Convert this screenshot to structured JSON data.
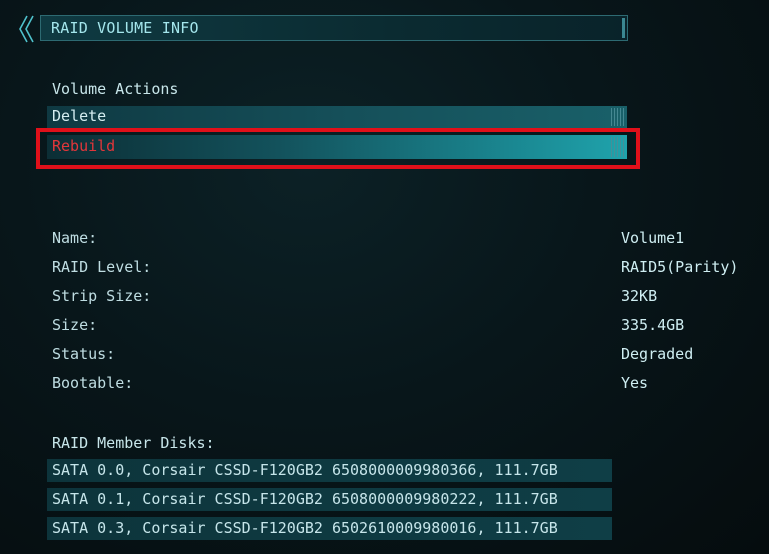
{
  "header": {
    "back_icon": "double-chevron-left-icon",
    "title": "RAID VOLUME INFO"
  },
  "volume_actions": {
    "heading": "Volume Actions",
    "items": [
      {
        "label": "Delete"
      },
      {
        "label": "Rebuild",
        "selected": true
      }
    ]
  },
  "info": {
    "rows": [
      {
        "label": "Name:",
        "value": "Volume1"
      },
      {
        "label": "RAID Level:",
        "value": "RAID5(Parity)"
      },
      {
        "label": "Strip Size:",
        "value": "32KB"
      },
      {
        "label": "Size:",
        "value": "335.4GB"
      },
      {
        "label": "Status:",
        "value": "Degraded"
      },
      {
        "label": "Bootable:",
        "value": "Yes"
      }
    ]
  },
  "member_disks": {
    "heading": "RAID Member Disks:",
    "items": [
      "SATA 0.0, Corsair CSSD-F120GB2 6508000009980366, 111.7GB",
      "SATA 0.1, Corsair CSSD-F120GB2 6508000009980222, 111.7GB",
      "SATA 0.3, Corsair CSSD-F120GB2 6502610009980016, 111.7GB"
    ]
  },
  "colors": {
    "accent": "#1fa3ac",
    "highlight": "#e0101a",
    "selected_text": "#e2363a"
  }
}
